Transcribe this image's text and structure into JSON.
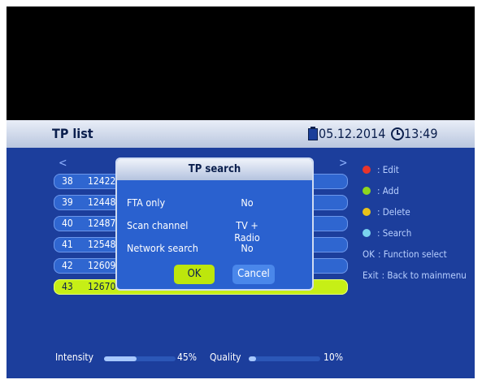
{
  "header": {
    "title": "TP list",
    "date": "05.12.2014",
    "time": "13:49"
  },
  "list": {
    "nav_left": "<",
    "nav_right": ">",
    "rows": [
      {
        "num": "38",
        "freq": "12422"
      },
      {
        "num": "39",
        "freq": "12448"
      },
      {
        "num": "40",
        "freq": "12487"
      },
      {
        "num": "41",
        "freq": "12548"
      },
      {
        "num": "42",
        "freq": "12609"
      },
      {
        "num": "43",
        "freq": "12670"
      }
    ],
    "selected_index": 5
  },
  "dialog": {
    "title": "TP search",
    "fields": [
      {
        "label": "FTA only",
        "value": "No"
      },
      {
        "label": "Scan channel",
        "value": "TV + Radio"
      },
      {
        "label": "Network search",
        "value": "No"
      }
    ],
    "ok_label": "OK",
    "cancel_label": "Cancel"
  },
  "signal": {
    "intensity_label": "Intensity",
    "intensity_value": "45%",
    "intensity_fraction": 0.45,
    "quality_label": "Quality",
    "quality_value": "10%",
    "quality_fraction": 0.1
  },
  "legend": [
    {
      "color": "#e8352c",
      "text": ": Edit"
    },
    {
      "color": "#8dd61e",
      "text": ": Add"
    },
    {
      "color": "#e8c21a",
      "text": ": Delete"
    },
    {
      "color": "#7ad4ee",
      "text": ": Search"
    },
    {
      "key": "OK",
      "text": ": Function select"
    },
    {
      "key": "Exit",
      "text": ": Back to mainmenu"
    }
  ]
}
